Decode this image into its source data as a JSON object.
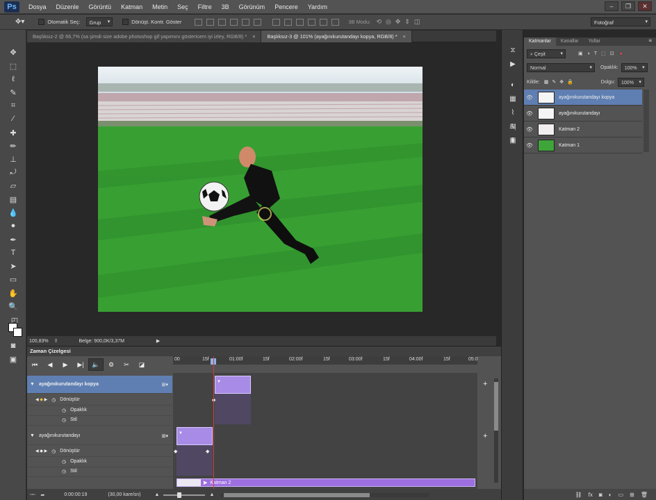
{
  "app": {
    "logo": "Ps"
  },
  "menu": [
    "Dosya",
    "Düzenle",
    "Görüntü",
    "Katman",
    "Metin",
    "Seç",
    "Filtre",
    "3B",
    "Görünüm",
    "Pencere",
    "Yardım"
  ],
  "options": {
    "auto_select_label": "Otomatik Seç:",
    "auto_select_value": "Grup",
    "transform_label": "Dönüşt. Kontr. Göster",
    "mode_3d": "3B Modu:",
    "workspace": "Fotoğraf"
  },
  "tabs": [
    {
      "label": "Başlıksız-2 @ 66,7% (sa şimdi size adobe photoshop gif yapımını göstericem iyi izley, RGB/8) *",
      "close": "×"
    },
    {
      "label": "Başlıksız-3 @ 101% (ayağınıkurutandayı kopya, RGB/8) *",
      "close": "×"
    }
  ],
  "status": {
    "zoom": "100,83%",
    "doc": "Belge: 900,0K/3,37M"
  },
  "timeline": {
    "title": "Zaman Çizelgesi",
    "ruler": [
      "00",
      "15f",
      "01:00f",
      "15f",
      "02:00f",
      "15f",
      "03:00f",
      "15f",
      "04:00f",
      "15f",
      "05:0"
    ],
    "layers": [
      {
        "name": "ayağınıkurutandayı kopya",
        "props": [
          "Dönüştür",
          "Opaklık",
          "Stil"
        ]
      },
      {
        "name": "ayağınıkurutandayı",
        "props": [
          "Dönüştür",
          "Opaklık",
          "Stil"
        ]
      }
    ],
    "bottom_layer": "Katman 2",
    "time": "0:00:00:19",
    "fps": "(30,00 kare/sn)"
  },
  "layers_panel": {
    "tabs": [
      "Katmanlar",
      "Kanallar",
      "Yollar"
    ],
    "kind": "Çeşit",
    "blend": "Normal",
    "opacity_label": "Opaklık:",
    "opacity": "100%",
    "lock_label": "Kilitle:",
    "fill_label": "Dolgu:",
    "fill": "100%",
    "layers": [
      "ayağınıkurutandayı kopya",
      "ayağınıkurutandayı",
      "Katman 2",
      "Katman 1"
    ]
  },
  "colors": {
    "accent": "#4a6fa5",
    "clip": "#9c7be0",
    "playhead": "#d83b3b"
  }
}
